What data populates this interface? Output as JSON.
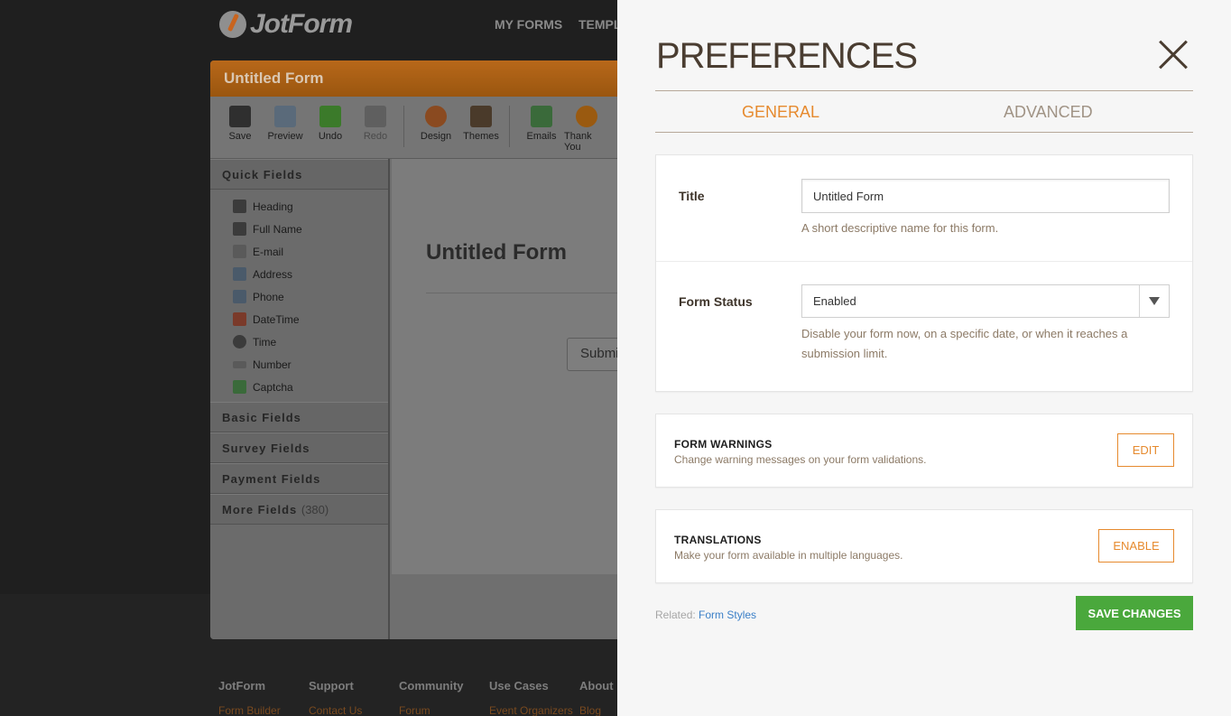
{
  "background": {
    "logo": "JotForm",
    "nav": [
      "MY FORMS",
      "TEMPL"
    ],
    "builder_title": "Untitled Form",
    "toolbar": [
      {
        "label": "Save",
        "icon": "save-icon",
        "color": "#3a3a3a"
      },
      {
        "label": "Preview",
        "icon": "preview-icon",
        "color": "#5a6a7a"
      },
      {
        "label": "Undo",
        "icon": "undo-icon",
        "color": "#3b7a2a"
      },
      {
        "label": "Redo",
        "icon": "redo-icon",
        "color": "#5a5a5a"
      },
      {
        "label": "Design",
        "icon": "design-icon",
        "color": "#8a4a20"
      },
      {
        "label": "Themes",
        "icon": "themes-icon",
        "color": "#4a3a2a"
      },
      {
        "label": "Emails",
        "icon": "emails-icon",
        "color": "#3a6a3a"
      },
      {
        "label": "Thank You",
        "icon": "thank-you-icon",
        "color": "#9a5a10"
      }
    ],
    "quick_fields_title": "Quick Fields",
    "quick_fields": [
      "Heading",
      "Full Name",
      "E-mail",
      "Address",
      "Phone",
      "DateTime",
      "Time",
      "Number",
      "Captcha"
    ],
    "sections": [
      {
        "title": "Basic Fields",
        "count": ""
      },
      {
        "title": "Survey Fields",
        "count": ""
      },
      {
        "title": "Payment Fields",
        "count": ""
      },
      {
        "title": "More Fields",
        "count": "(380)"
      }
    ],
    "canvas_title": "Untitled Form",
    "submit_label": "Submi",
    "footer_cols": [
      "JotForm",
      "Support",
      "Community",
      "Use Cases",
      "About"
    ],
    "footer_links": [
      "Form Builder",
      "Contact Us",
      "Forum",
      "Event Organizers",
      "Blog"
    ]
  },
  "panel": {
    "title": "PREFERENCES",
    "tabs": [
      "GENERAL",
      "ADVANCED"
    ],
    "title_field": {
      "label": "Title",
      "value": "Untitled Form",
      "hint": "A short descriptive name for this form."
    },
    "status_field": {
      "label": "Form Status",
      "value": "Enabled",
      "hint": "Disable your form now, on a specific date, or when it reaches a submission limit."
    },
    "warnings": {
      "title": "FORM WARNINGS",
      "desc": "Change warning messages on your form validations.",
      "button": "EDIT"
    },
    "translations": {
      "title": "TRANSLATIONS",
      "desc": "Make your form available in multiple languages.",
      "button": "ENABLE"
    },
    "related_prefix": "Related:",
    "related_link": "Form Styles",
    "save_label": "SAVE CHANGES",
    "colors": {
      "accent": "#e68a2e",
      "save": "#4aa83c",
      "link": "#3a7fc7"
    }
  }
}
